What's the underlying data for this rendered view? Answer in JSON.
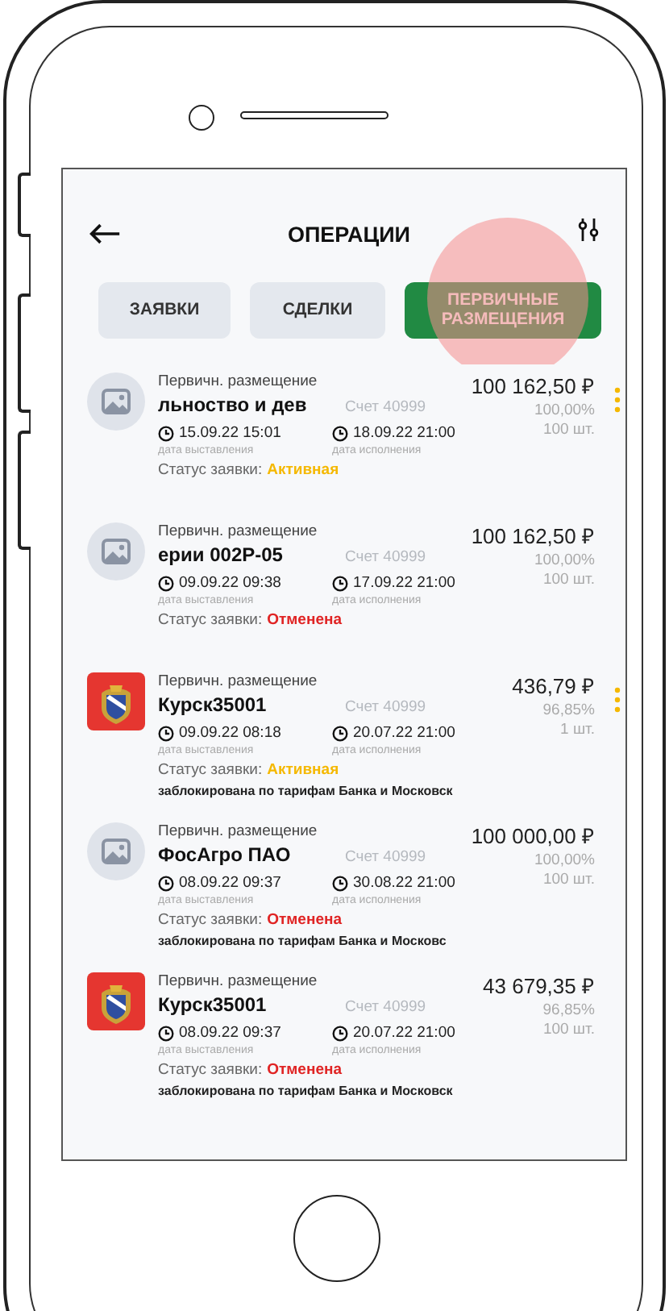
{
  "header": {
    "title": "ОПЕРАЦИИ"
  },
  "tabs": [
    {
      "label": "ЗАЯВКИ",
      "selected": false
    },
    {
      "label": "СДЕЛКИ",
      "selected": false
    },
    {
      "label": "ПЕРВИЧНЫЕ РАЗМЕЩЕНИЯ",
      "selected": true
    }
  ],
  "operations": [
    {
      "kind": "placeholder",
      "type": "Первичн. размещение",
      "title": "льноство и дев",
      "account": "Счет 40999",
      "amount": "100 162,50 ₽",
      "percent": "100,00%",
      "quantity": "100 шт.",
      "issued": "15.09.22 15:01",
      "issued_caption": "дата выставления",
      "executed": "18.09.22 21:00",
      "executed_caption": "дата исполнения",
      "status_label": "Статус заявки:",
      "status": {
        "text": "Активная",
        "kind": "active"
      },
      "has_menu": true
    },
    {
      "kind": "placeholder",
      "type": "Первичн. размещение",
      "title": "ерии 002P-05",
      "account": "Счет 40999",
      "amount": "100 162,50 ₽",
      "percent": "100,00%",
      "quantity": "100 шт.",
      "issued": "09.09.22 09:38",
      "issued_caption": "дата выставления",
      "executed": "17.09.22 21:00",
      "executed_caption": "дата исполнения",
      "status_label": "Статус заявки:",
      "status": {
        "text": "Отменена",
        "kind": "cancelled"
      },
      "has_menu": false
    },
    {
      "kind": "coat-of-arms",
      "type": "Первичн. размещение",
      "title": "Курск35001",
      "account": "Счет 40999",
      "amount": "436,79 ₽",
      "percent": "96,85%",
      "quantity": "1 шт.",
      "issued": "09.09.22 08:18",
      "issued_caption": "дата выставления",
      "executed": "20.07.22 21:00",
      "executed_caption": "дата исполнения",
      "status_label": "Статус заявки:",
      "status": {
        "text": "Активная",
        "kind": "active"
      },
      "note": "заблокирована по тарифам Банка и Московск",
      "has_menu": true
    },
    {
      "kind": "placeholder",
      "type": "Первичн. размещение",
      "title": "ФосАгро ПАО",
      "account": "Счет 40999",
      "amount": "100 000,00 ₽",
      "percent": "100,00%",
      "quantity": "100 шт.",
      "issued": "08.09.22 09:37",
      "issued_caption": "дата выставления",
      "executed": "30.08.22 21:00",
      "executed_caption": "дата исполнения",
      "status_label": "Статус заявки:",
      "status": {
        "text": "Отменена",
        "kind": "cancelled"
      },
      "note": "заблокирована по тарифам Банка и Московс",
      "has_menu": false
    },
    {
      "kind": "coat-of-arms",
      "type": "Первичн. размещение",
      "title": "Курск35001",
      "account": "Счет 40999",
      "amount": "43 679,35 ₽",
      "percent": "96,85%",
      "quantity": "100 шт.",
      "issued": "08.09.22 09:37",
      "issued_caption": "дата выставления",
      "executed": "20.07.22 21:00",
      "executed_caption": "дата исполнения",
      "status_label": "Статус заявки:",
      "status": {
        "text": "Отменена",
        "kind": "cancelled"
      },
      "note": "заблокирована по тарифам Банка и Московск",
      "has_menu": false
    }
  ]
}
